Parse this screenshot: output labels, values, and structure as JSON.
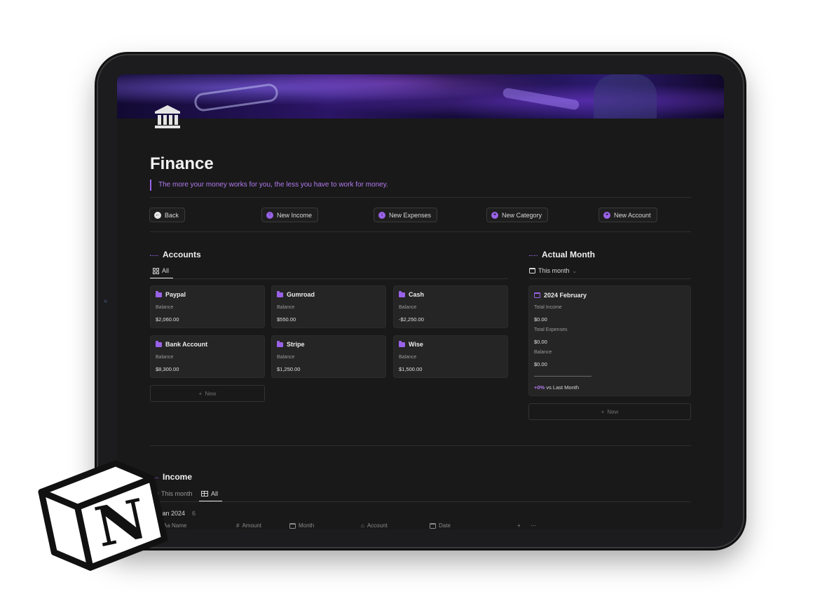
{
  "page": {
    "title": "Finance",
    "quote": "The more your money works for you, the less you have to work for money."
  },
  "buttons": {
    "back": "Back",
    "new_income": "New Income",
    "new_expenses": "New Expenses",
    "new_category": "New Category",
    "new_account": "New Account"
  },
  "accounts": {
    "heading": "Accounts",
    "tab": "All",
    "balance_label": "Balance",
    "new_label": "New",
    "items": [
      {
        "name": "Paypal",
        "balance": "$2,060.00"
      },
      {
        "name": "Gumroad",
        "balance": "$550.00"
      },
      {
        "name": "Cash",
        "balance": "-$2,250.00"
      },
      {
        "name": "Bank Account",
        "balance": "$8,300.00"
      },
      {
        "name": "Stripe",
        "balance": "$1,250.00"
      },
      {
        "name": "Wise",
        "balance": "$1,500.00"
      }
    ]
  },
  "actual_month": {
    "heading": "Actual Month",
    "filter": "This month",
    "card_title": "2024 February",
    "total_income_label": "Total Income",
    "total_income": "$0.00",
    "total_expenses_label": "Total Expenses",
    "total_expenses": "$0.00",
    "balance_label": "Balance",
    "balance": "$0.00",
    "change_pct": "+0%",
    "change_text": "vs Last Month",
    "new_label": "New"
  },
  "income": {
    "heading": "Income",
    "tabs": [
      "This month",
      "All"
    ],
    "group": "Jan 2024",
    "group_count": "6",
    "columns": [
      "Aa Name",
      "Amount",
      "Month",
      "Account",
      "Date"
    ]
  },
  "icons": {
    "page_icon": "bank-icon",
    "logo": "notion-logo"
  },
  "colors": {
    "accent": "#9a62e8",
    "background": "#191919",
    "card": "#252525"
  }
}
